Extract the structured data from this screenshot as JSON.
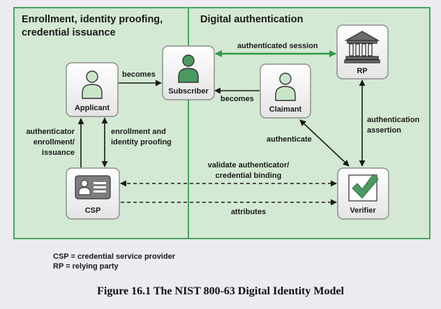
{
  "panels": {
    "left_title_line1": "Enrollment, identity proofing,",
    "left_title_line2": "credential issuance",
    "right_title": "Digital authentication"
  },
  "nodes": {
    "applicant": "Applicant",
    "subscriber": "Subscriber",
    "claimant": "Claimant",
    "rp": "RP",
    "csp": "CSP",
    "verifier": "Verifier"
  },
  "edges": {
    "becomes_1": "becomes",
    "becomes_2": "becomes",
    "authenticated_session": "authenticated session",
    "authenticator_line1": "authenticator",
    "authenticator_line2": "enrollment/",
    "authenticator_line3": "issuance",
    "enrollment_line1": "enrollment and",
    "enrollment_line2": "identity proofing",
    "authenticate": "authenticate",
    "auth_assertion_line1": "authentication",
    "auth_assertion_line2": "assertion",
    "validate_line1": "validate authenticator/",
    "validate_line2": "credential binding",
    "attributes": "attributes"
  },
  "legend": {
    "csp": "CSP = credential service provider",
    "rp": "RP = relying party"
  },
  "caption": "Figure 16.1  The NIST 800-63 Digital Identity Model",
  "colors": {
    "panel_fill": "#d3e9d3",
    "panel_border": "#45a55f",
    "person_green": "#4a9a62",
    "session_arrow": "#2e9a48",
    "box_border": "#7a7a7a"
  }
}
